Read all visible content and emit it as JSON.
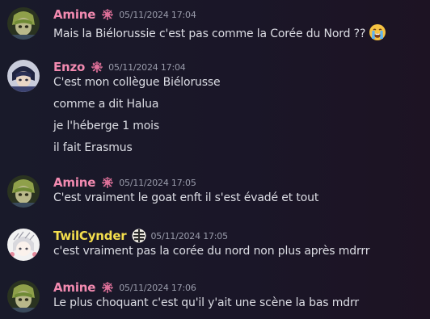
{
  "colors": {
    "amine": "#f28ab0",
    "enzo": "#f28ab0",
    "twilcynder": "#f5df4d",
    "timestamp": "#9a9cab",
    "text": "#dcdde4"
  },
  "messages": [
    {
      "author": "Amine",
      "badge_icon": "flower-emblem-icon",
      "timestamp": "05/11/2024 17:04",
      "lines": [
        "Mais la Biélorussie c'est pas comme la Corée du Nord ??"
      ],
      "trailing_emoji": "loudly-crying-face-emoji"
    },
    {
      "author": "Enzo",
      "badge_icon": "flower-emblem-icon",
      "timestamp": "05/11/2024 17:04",
      "lines": [
        "C'est mon collègue Biélorusse",
        "comme a dit Halua",
        "je l'héberge 1 mois",
        "il fait Erasmus"
      ]
    },
    {
      "author": "Amine",
      "badge_icon": "flower-emblem-icon",
      "timestamp": "05/11/2024 17:05",
      "lines": [
        "C'est vraiment le goat enft il s'est évadé et tout"
      ]
    },
    {
      "author": "TwilCynder",
      "badge_icon": "striped-circle-icon",
      "timestamp": "05/11/2024 17:05",
      "lines": [
        "c'est vraiment pas la corée du nord non plus après mdrrr"
      ]
    },
    {
      "author": "Amine",
      "badge_icon": "flower-emblem-icon",
      "timestamp": "05/11/2024 17:06",
      "lines": [
        "Le plus choquant c'est qu'il y'ait une scène la bas mdrr"
      ]
    }
  ]
}
